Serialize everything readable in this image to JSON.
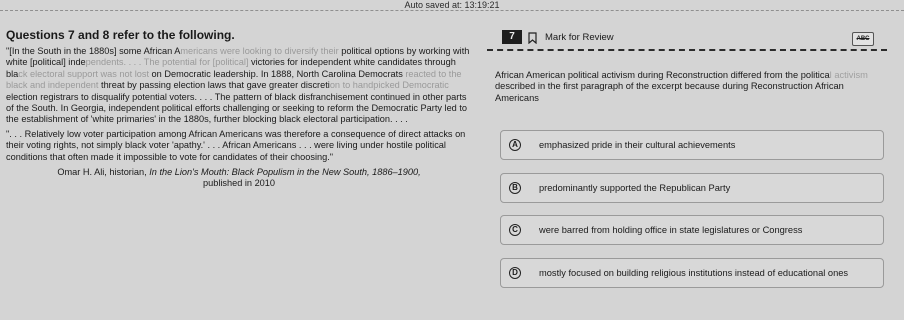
{
  "header": {
    "autosave": "Auto saved at: 13:19:21"
  },
  "passage": {
    "heading": "Questions 7 and 8 refer to the following.",
    "p1": [
      {
        "text": "\"[In the South in the 1880s] some African A",
        "muted": false
      },
      {
        "text": "mericans were looking to diversify their",
        "muted": true
      },
      {
        "text": " political options by working with white [political] inde",
        "muted": false
      },
      {
        "text": "pendents. . . . The potential for [political]",
        "muted": true
      },
      {
        "text": " victories for independent white candidates through bla",
        "muted": false
      },
      {
        "text": "ck electoral support was not lost",
        "muted": true
      },
      {
        "text": " on Democratic leadership. In 1888, North Carolina Democrats ",
        "muted": false
      },
      {
        "text": "reacted to the black and independent",
        "muted": true
      },
      {
        "text": " threat by passing election laws that gave greater discreti",
        "muted": false
      },
      {
        "text": "on to handpicked Democratic",
        "muted": true
      },
      {
        "text": " election registrars to disqualify potential voters. . . . The pattern of black disfranchisement continued in other parts of the South. In Georgia, independent political efforts challenging or seeking to reform the Democratic Party led to the establishment of 'white primaries' in the 1880s, further blocking black electoral participation. . . .",
        "muted": false
      }
    ],
    "p2": "\". . . Relatively low voter participation among African Americans was therefore a consequence of direct attacks on their voting rights, not simply black voter 'apathy.' . . . African Americans . . . were living under hostile political conditions that often made it impossible to vote for candidates of their choosing.\"",
    "citation_author": "Omar H. Ali, historian, ",
    "citation_work": "In the Lion's Mouth: Black Populism in the New South, 1886–1900,",
    "citation_pub": "published in 2010"
  },
  "question": {
    "number": "7",
    "mark_label": "Mark for Review",
    "abc_label": "ABC",
    "stem_a": "African American political activism during Reconstruction differed from the politica",
    "stem_fade": "l activism",
    "stem_b": " described in the first paragraph of the excerpt because during Reconstruction African Americans",
    "options": [
      {
        "letter": "A",
        "text": "emphasized pride in their cultural achievements"
      },
      {
        "letter": "B",
        "text": "predominantly supported the Republican Party"
      },
      {
        "letter": "C",
        "text": "were barred from holding office in state legislatures or Congress"
      },
      {
        "letter": "D",
        "text": "mostly focused on building religious institutions instead of educational ones"
      }
    ]
  }
}
